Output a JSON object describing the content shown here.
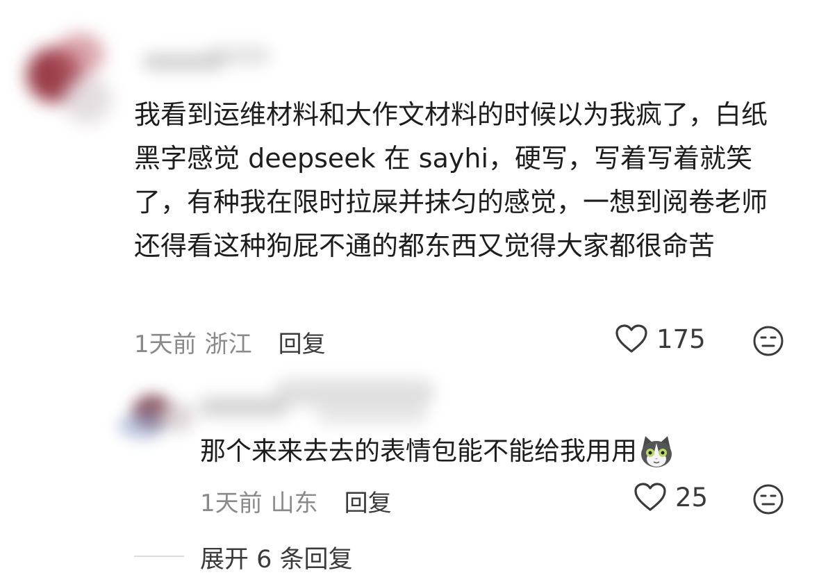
{
  "comment": {
    "text": "我看到运维材料和大作文材料的时候以为我疯了，白纸黑字感觉 deepseek 在 sayhi，硬写，写着写着就笑了，有种我在限时拉屎并抹匀的感觉，一想到阅卷老师还得看这种狗屁不通的都东西又觉得大家都很命苦",
    "time": "1天前",
    "location": "浙江",
    "reply_label": "回复",
    "likes": "175",
    "like_icon": "heart-outline-icon",
    "dislike_icon": "meh-face-icon"
  },
  "reply": {
    "text": "那个来来去去的表情包能不能给我用用",
    "emoji": "cat-face-emoji",
    "time": "1天前",
    "location": "山东",
    "reply_label": "回复",
    "likes": "25",
    "like_icon": "heart-outline-icon",
    "dislike_icon": "meh-face-icon"
  },
  "expand_replies": "展开 6 条回复",
  "colors": {
    "text": "#1d1d1d",
    "meta": "#8a8a8a",
    "icon": "#3a3a3a"
  }
}
